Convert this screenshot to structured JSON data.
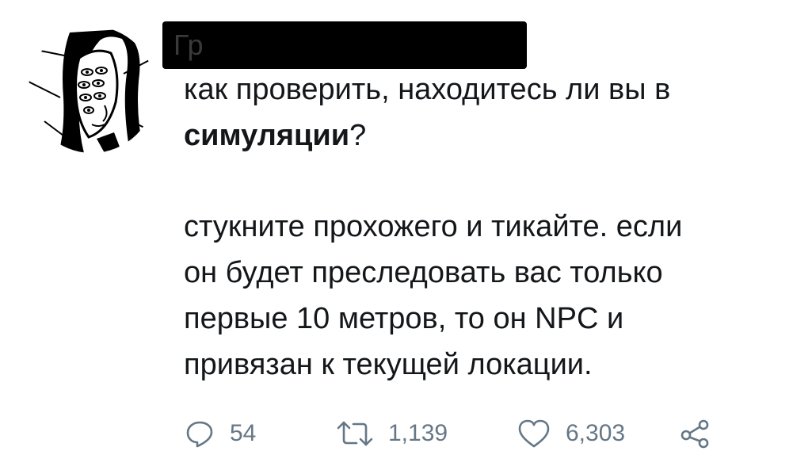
{
  "tweet": {
    "author_redacted_visible": "Гр",
    "line1": "как проверить, находитесь ли вы в",
    "line2_bold": "симуляции",
    "line2_rest": "?",
    "paragraph2": "стукните прохожего и тикайте. если\nон будет преследовать вас только\nпервые 10 метров, то он NPC и\nпривязан к текущей локации."
  },
  "actions": {
    "reply": {
      "icon": "reply-icon",
      "count": "54"
    },
    "retweet": {
      "icon": "retweet-icon",
      "count": "1,139"
    },
    "like": {
      "icon": "heart-icon",
      "count": "6,303"
    },
    "share": {
      "icon": "share-icon"
    }
  },
  "colors": {
    "text": "#14171a",
    "muted": "#657786",
    "redaction": "#000000"
  }
}
